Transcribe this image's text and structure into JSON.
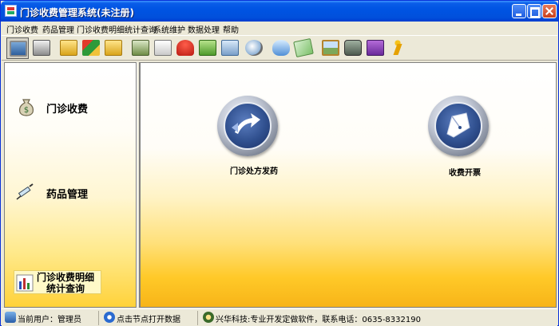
{
  "window": {
    "title": "门诊收费管理系统(未注册)"
  },
  "menu": [
    "门诊收费",
    "药品管理",
    "门诊收费明细统计查询",
    "系统维护",
    "数据处理",
    "帮助"
  ],
  "toolbar_icons": [
    "monitor-icon",
    "printer-icon",
    "folder-icon",
    "money-transfer-icon",
    "folder-open-icon",
    "gear-folder-icon",
    "document-edit-icon",
    "umbrella-icon",
    "notebook-icon",
    "search-document-icon",
    "magnifier-icon",
    "water-drop-icon",
    "banknote-icon",
    "picture-icon",
    "pda-icon",
    "help-book-icon",
    "running-man-icon"
  ],
  "sidebar": {
    "items": [
      {
        "label": "门诊收费",
        "icon": "money-bag-icon"
      },
      {
        "label": "药品管理",
        "icon": "syringe-icon"
      },
      {
        "label_line1": "门诊收费明细",
        "label_line2": "统计查询",
        "icon": "bar-chart-icon"
      }
    ]
  },
  "main": {
    "buttons": [
      {
        "label": "门诊处方发药",
        "icon": "arrow-share-icon"
      },
      {
        "label": "收费开票",
        "icon": "pen-nib-icon"
      }
    ]
  },
  "status": {
    "user": "当前用户：管理员",
    "hint": "点击节点打开数据",
    "company": "兴华科技:专业开发定做软件，联系电话：0635-8332190"
  },
  "colors": {
    "titlebar": "#0054e3",
    "accent_yellow": "#ffd23a"
  }
}
